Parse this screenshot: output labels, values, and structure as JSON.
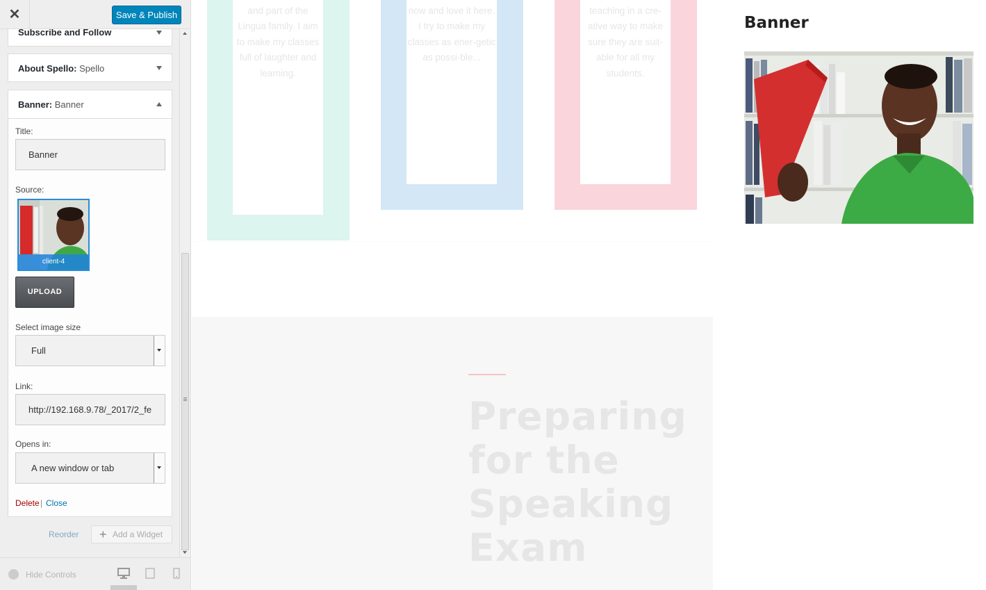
{
  "topbar": {
    "close_icon": "close-icon",
    "close_glyph": "✕",
    "save_label": "Save & Publish"
  },
  "sections": {
    "subscribe": {
      "label": "Subscribe and Follow"
    },
    "about": {
      "label": "About Spello:",
      "sub": "Spello"
    },
    "banner": {
      "label": "Banner:",
      "sub": "Banner"
    }
  },
  "widget": {
    "title_label": "Title:",
    "title_value": "Banner",
    "source_label": "Source:",
    "thumb_caption": "client-4",
    "upload_label": "UPLOAD",
    "size_label": "Select image size",
    "size_value": "Full",
    "link_label": "Link:",
    "link_value": "http://192.168.9.78/_2017/2_fe",
    "opens_label": "Opens in:",
    "opens_value": "A new window or tab",
    "delete_label": "Delete",
    "separator": "|",
    "close_label": "Close"
  },
  "footer_actions": {
    "reorder_label": "Reorder",
    "add_widget_plus": "+",
    "add_widget_label": "Add a Widget",
    "hide_controls_label": "Hide Controls",
    "devices": [
      "desktop-icon",
      "tablet-icon",
      "mobile-icon"
    ]
  },
  "preview": {
    "cards": [
      {
        "color": "#dcf5ee",
        "text": "and part of the Lingua family. I aim to make my classes full of laughter and learning."
      },
      {
        "color": "#d3e7f7",
        "text": "now and love it here. I try to make my classes as ener-getic as possi-ble..."
      },
      {
        "color": "#fbd5dc",
        "text": "teaching in a cre-ative way to make sure they are suit-able for all my students."
      }
    ],
    "headline": "Preparing for the Speaking Exam",
    "banner_title": "Banner"
  },
  "colors": {
    "accent": "#0085ba",
    "delete": "#aa0000",
    "link": "#0073aa"
  }
}
